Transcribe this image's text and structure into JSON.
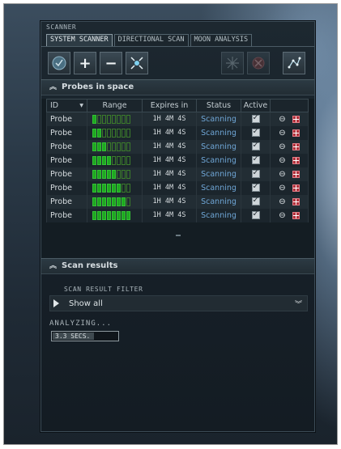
{
  "window": {
    "title": "SCANNER"
  },
  "tabs": [
    {
      "label": "SYSTEM SCANNER",
      "active": true
    },
    {
      "label": "DIRECTIONAL SCAN",
      "active": false
    },
    {
      "label": "MOON ANALYSIS",
      "active": false
    }
  ],
  "toolbar": {
    "buttons": [
      {
        "icon": "analyze-icon",
        "enabled": true
      },
      {
        "icon": "plus-icon",
        "label": "+",
        "enabled": true
      },
      {
        "icon": "minus-icon",
        "label": "−",
        "enabled": true
      },
      {
        "icon": "spread-probes-icon",
        "enabled": true
      },
      {
        "icon": "star-burst-icon",
        "enabled": false
      },
      {
        "icon": "recall-icon",
        "enabled": false
      },
      {
        "icon": "map-icon",
        "enabled": true
      }
    ]
  },
  "probes_section": {
    "title": "Probes in space",
    "columns": [
      "ID",
      "Range",
      "Expires in",
      "Status",
      "Active"
    ],
    "rows": [
      {
        "id": "Probe",
        "range_level": 1,
        "expires": "1H 4M 4S",
        "status": "Scanning"
      },
      {
        "id": "Probe",
        "range_level": 2,
        "expires": "1H 4M 4S",
        "status": "Scanning"
      },
      {
        "id": "Probe",
        "range_level": 3,
        "expires": "1H 4M 4S",
        "status": "Scanning"
      },
      {
        "id": "Probe",
        "range_level": 4,
        "expires": "1H 4M 4S",
        "status": "Scanning"
      },
      {
        "id": "Probe",
        "range_level": 5,
        "expires": "1H 4M 4S",
        "status": "Scanning"
      },
      {
        "id": "Probe",
        "range_level": 6,
        "expires": "1H 4M 4S",
        "status": "Scanning"
      },
      {
        "id": "Probe",
        "range_level": 7,
        "expires": "1H 4M 4S",
        "status": "Scanning"
      },
      {
        "id": "Probe",
        "range_level": 8,
        "expires": "1H 4M 4S",
        "status": "Scanning"
      }
    ],
    "range_max": 8
  },
  "results_section": {
    "title": "Scan results",
    "filter_label": "SCAN RESULT FILTER",
    "filter_value": "Show all",
    "analyzing_label": "ANALYZING...",
    "timer_text": "3.3 SECS.",
    "timer_progress": 0.65
  },
  "colors": {
    "status_text": "#6fa6d6",
    "range_on": "#1ea820",
    "destroy": "#b0303a"
  }
}
